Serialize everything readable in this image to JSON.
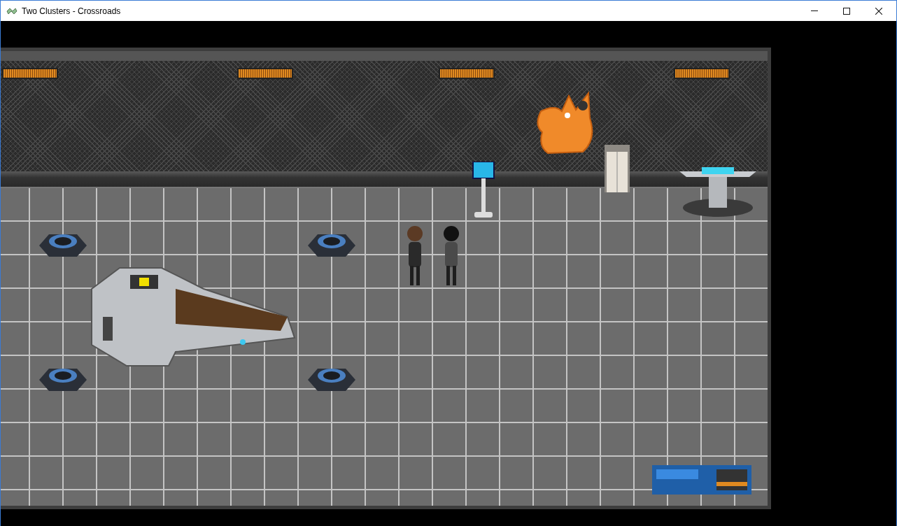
{
  "window": {
    "title": "Two Clusters - Crossroads"
  }
}
